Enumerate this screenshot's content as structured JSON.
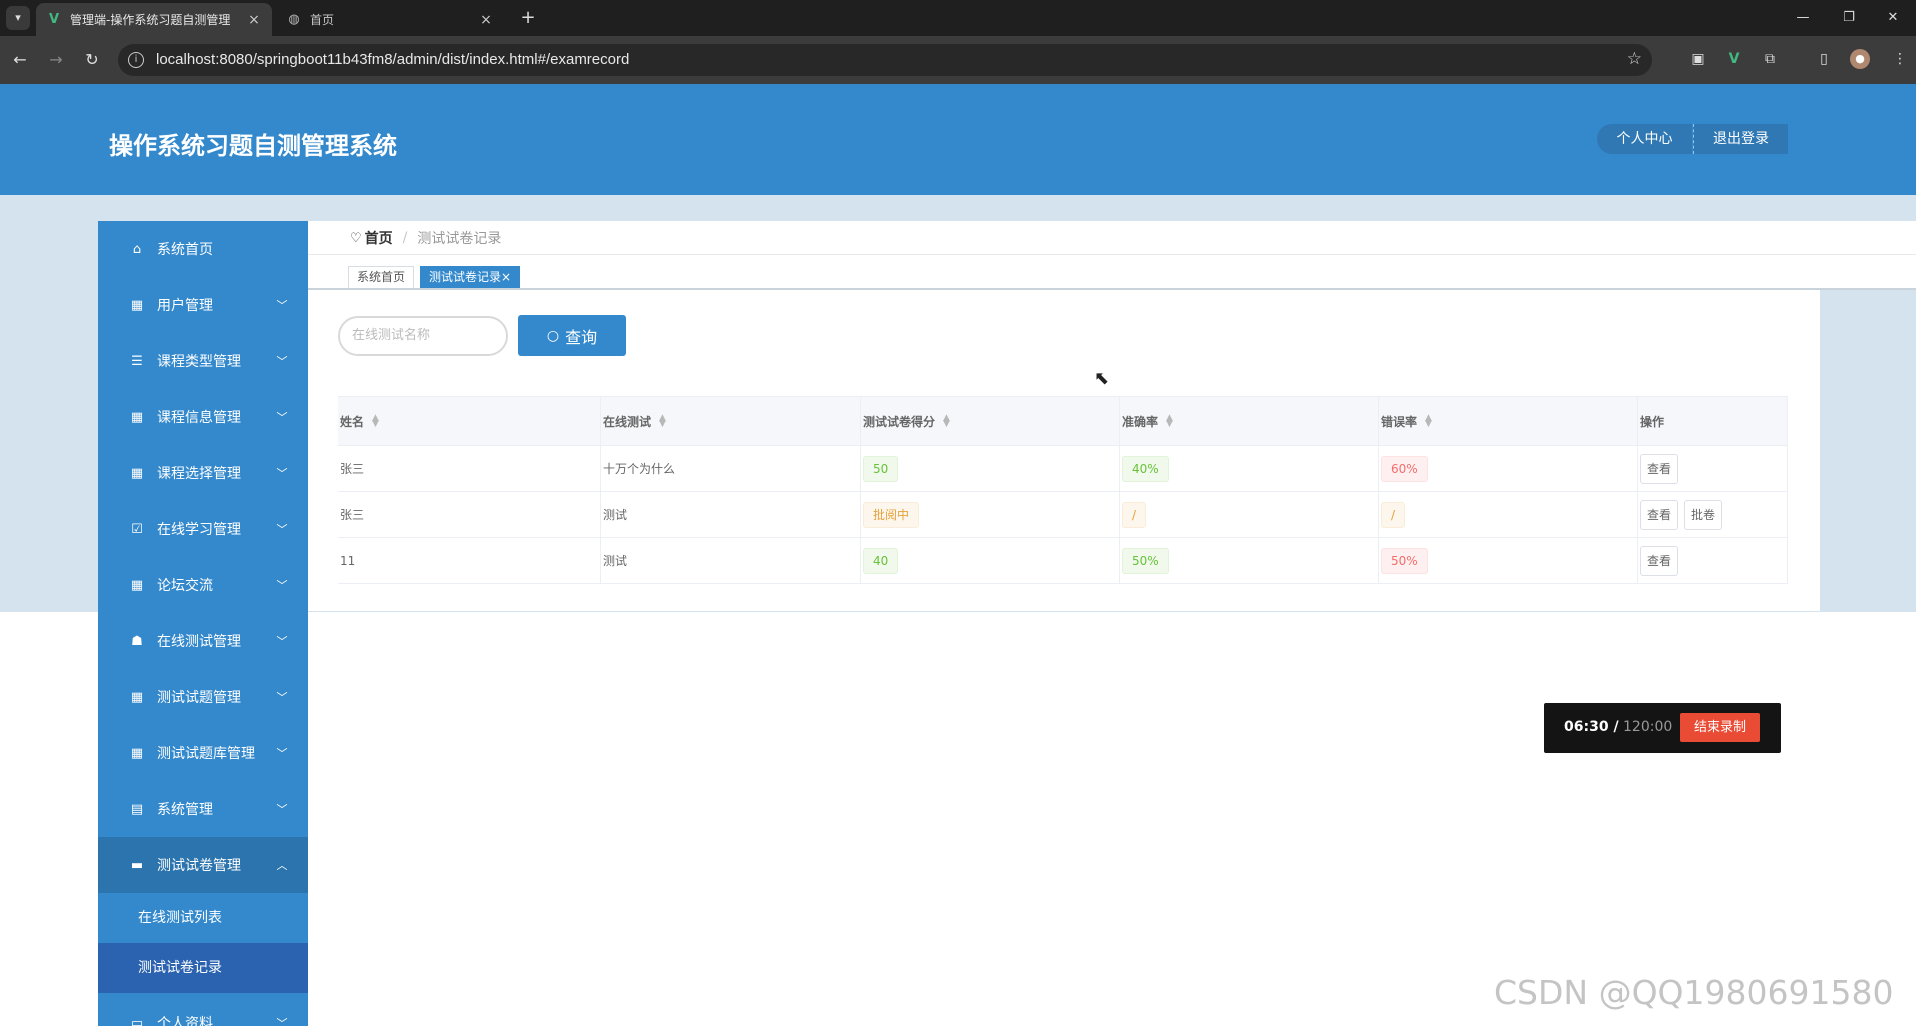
{
  "browser": {
    "tabs": [
      {
        "title": "管理端-操作系统习题自测管理",
        "close": "×"
      },
      {
        "title": "首页",
        "close": "×"
      }
    ],
    "new_tab": "+",
    "url": "localhost:8080/springboot11b43fm8/admin/dist/index.html#/examrecord"
  },
  "header": {
    "title": "操作系统习题自测管理系统",
    "profile_btn": "个人中心",
    "logout_btn": "退出登录"
  },
  "sidebar": {
    "items": [
      {
        "label": "系统首页",
        "icon": "home-icon",
        "chevron": ""
      },
      {
        "label": "用户管理",
        "icon": "grid-icon",
        "chevron": "﹀"
      },
      {
        "label": "课程类型管理",
        "icon": "list-icon",
        "chevron": "﹀"
      },
      {
        "label": "课程信息管理",
        "icon": "grid-icon",
        "chevron": "﹀"
      },
      {
        "label": "课程选择管理",
        "icon": "grid-icon",
        "chevron": "﹀"
      },
      {
        "label": "在线学习管理",
        "icon": "checkbox-icon",
        "chevron": "﹀"
      },
      {
        "label": "论坛交流",
        "icon": "grid-icon",
        "chevron": "﹀"
      },
      {
        "label": "在线测试管理",
        "icon": "thumb-icon",
        "chevron": "﹀"
      },
      {
        "label": "测试试题管理",
        "icon": "grid-icon",
        "chevron": "﹀"
      },
      {
        "label": "测试试题库管理",
        "icon": "grid-icon",
        "chevron": "﹀"
      },
      {
        "label": "系统管理",
        "icon": "chat-icon",
        "chevron": "﹀"
      },
      {
        "label": "测试试卷管理",
        "icon": "printer-icon",
        "chevron": "︿"
      }
    ],
    "sub_items": [
      "在线测试列表",
      "测试试卷记录"
    ],
    "last_item": {
      "label": "个人资料",
      "icon": "card-icon",
      "chevron": "﹀"
    }
  },
  "breadcrumb": {
    "home": "首页",
    "sep": "/",
    "current": "测试试卷记录"
  },
  "tags": [
    {
      "label": "系统首页"
    },
    {
      "label": "测试试卷记录",
      "close": "×"
    }
  ],
  "search": {
    "placeholder": "在线测试名称",
    "button": "查询"
  },
  "table": {
    "columns": [
      "姓名",
      "在线测试",
      "测试试卷得分",
      "准确率",
      "错误率",
      "操作"
    ],
    "rows": [
      {
        "name": "张三",
        "test": "十万个为什么",
        "score": "50",
        "accuracy": "40%",
        "error": "60%",
        "actions": [
          "查看"
        ]
      },
      {
        "name": "张三",
        "test": "测试",
        "score": "批阅中",
        "accuracy": "/",
        "error": "/",
        "actions": [
          "查看",
          "批卷"
        ]
      },
      {
        "name": "11",
        "test": "测试",
        "score": "40",
        "accuracy": "50%",
        "error": "50%",
        "actions": [
          "查看"
        ]
      }
    ]
  },
  "recording": {
    "elapsed": "06:30 /",
    "total": " 120:00",
    "stop": "结束录制"
  },
  "watermark": "CSDN @QQ1980691580",
  "colors": {
    "primary": "#3489cd",
    "band": "#d5e3ef",
    "recording": "#e94b35"
  }
}
